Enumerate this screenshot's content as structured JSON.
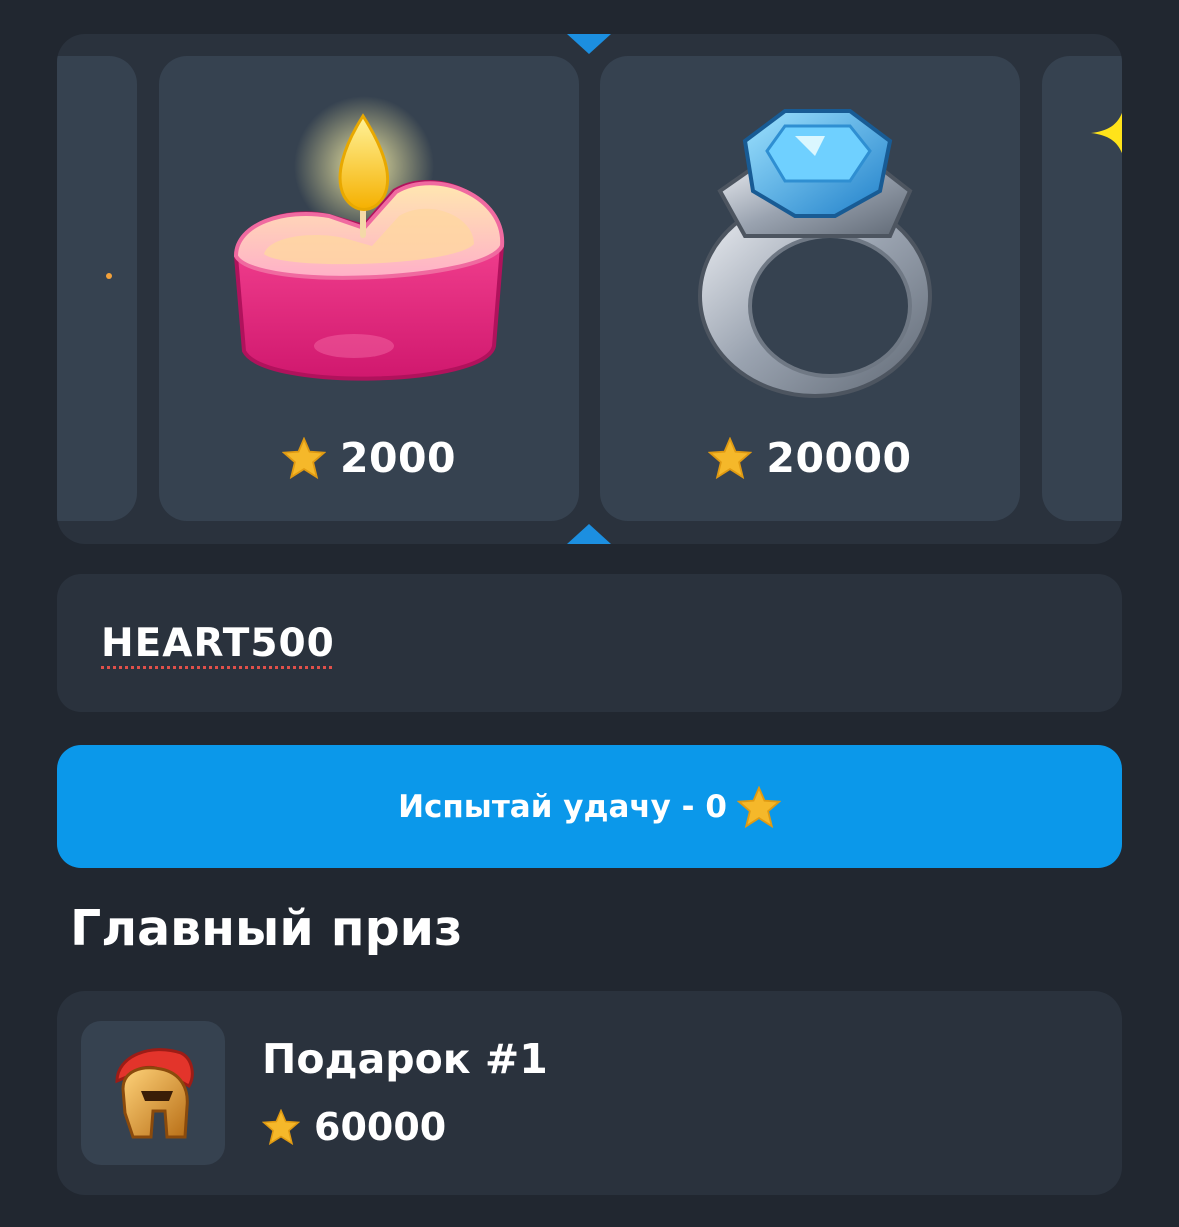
{
  "carousel": {
    "items": [
      {
        "icon": "heart-candle-icon",
        "price": "2000"
      },
      {
        "icon": "diamond-ring-icon",
        "price": "20000"
      }
    ],
    "pointer_color": "#1c8fe0"
  },
  "promo": {
    "value": "HEART500"
  },
  "spin_button": {
    "label": "Испытай удачу - 0",
    "color": "#0b98ea"
  },
  "main_prize": {
    "title": "Главный приз",
    "name": "Подарок #1",
    "price": "60000",
    "icon": "spartan-helmet-icon"
  },
  "icons": {
    "currency": "star-icon"
  }
}
